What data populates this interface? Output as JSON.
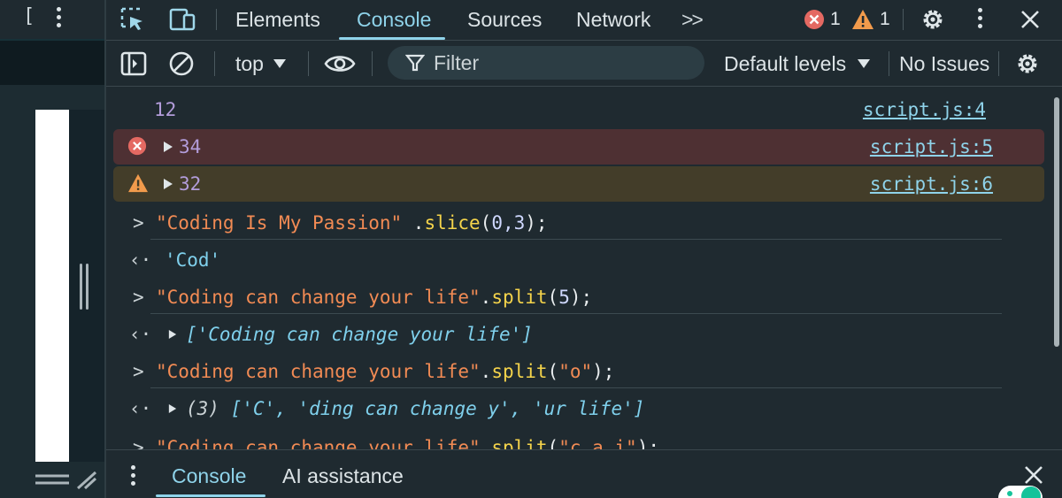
{
  "left_panel": {
    "bracket": "["
  },
  "tabbar": {
    "tabs": [
      {
        "label": "Elements"
      },
      {
        "label": "Console"
      },
      {
        "label": "Sources"
      },
      {
        "label": "Network"
      }
    ],
    "more_tabs": ">>",
    "error_count": "1",
    "warning_count": "1",
    "accent_color": "#8fd3ea"
  },
  "toolbar": {
    "context": "top",
    "filter_placeholder": "Filter",
    "levels": "Default levels",
    "issues": "No Issues"
  },
  "console": {
    "messages": [
      {
        "type": "log",
        "text": "12",
        "source": "script.js:4"
      },
      {
        "type": "error",
        "text": "34",
        "source": "script.js:5"
      },
      {
        "type": "warning",
        "text": "32",
        "source": "script.js:6"
      }
    ],
    "entries": [
      {
        "input": {
          "str": "\"Coding Is My Passion\"",
          "mid": " .",
          "fn": "slice",
          "args_open": "(",
          "args": "0,3",
          "args_close": ");"
        },
        "output": "'Cod'"
      },
      {
        "input": {
          "str": "\"Coding can change your life\"",
          "mid": ".",
          "fn": "split",
          "args_open": "(",
          "args": "5",
          "args_close": ");"
        },
        "output": "['Coding can change your life']"
      },
      {
        "input": {
          "str": "\"Coding can change your life\"",
          "mid": ".",
          "fn": "split",
          "args_open": "(",
          "args": "\"o\"",
          "args_close": ");"
        },
        "output_prefix": "(3) ",
        "output": "['C', 'ding can change y', 'ur life']"
      },
      {
        "input": {
          "str": "\"Coding can change your life\"",
          "mid": ".",
          "fn": "split",
          "args_open": "(",
          "args": "\"c a i\"",
          "args_close": ");"
        }
      }
    ]
  },
  "drawer": {
    "tabs": [
      {
        "label": "Console"
      },
      {
        "label": "AI assistance"
      }
    ]
  },
  "colors": {
    "error_bg": "#4e3033",
    "warning_bg": "#433d29",
    "error_icon": "#e46962",
    "warning_icon": "#f29b4c",
    "string": "#f28b54",
    "function": "#f5d44b"
  }
}
